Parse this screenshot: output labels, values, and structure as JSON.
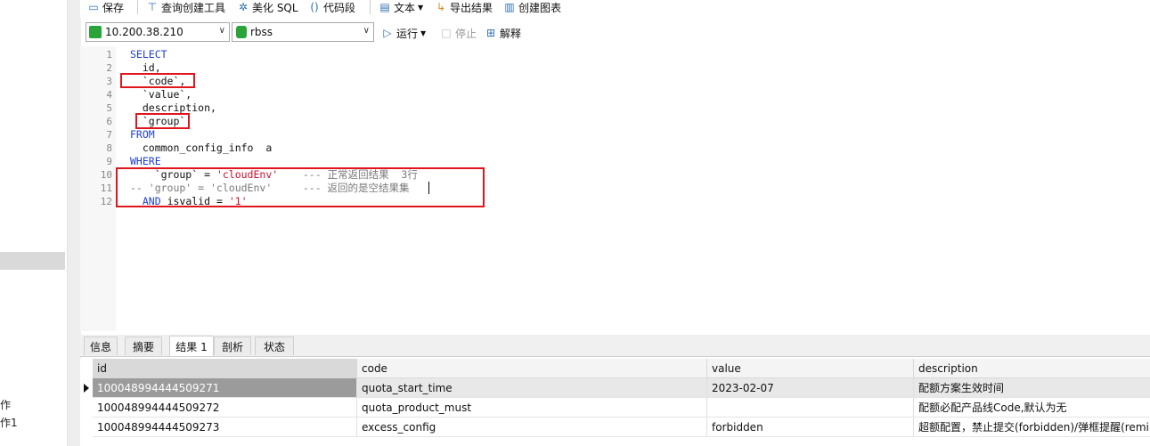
{
  "sidebar": {
    "items": [
      "作",
      "作1"
    ]
  },
  "toolbar": {
    "save": "保存",
    "query_builder": "查询创建工具",
    "beautify_sql": "美化 SQL",
    "code_snippet": "代码段",
    "text": "文本",
    "export_results": "导出结果",
    "create_chart": "创建图表",
    "connection": "10.200.38.210",
    "database": "rbss",
    "run": "运行",
    "stop": "停止",
    "explain": "解释"
  },
  "editor": {
    "line_numbers": [
      "1",
      "2",
      "3",
      "4",
      "5",
      "6",
      "7",
      "8",
      "9",
      "10",
      "11",
      "12"
    ],
    "lines": [
      {
        "parts": [
          {
            "t": "SELECT",
            "c": "kw"
          }
        ]
      },
      {
        "parts": [
          {
            "t": "  id,",
            "c": ""
          }
        ]
      },
      {
        "parts": [
          {
            "t": "  `code`,",
            "c": ""
          }
        ]
      },
      {
        "parts": [
          {
            "t": "  `value`,",
            "c": ""
          }
        ]
      },
      {
        "parts": [
          {
            "t": "  description,",
            "c": ""
          }
        ]
      },
      {
        "parts": [
          {
            "t": "  `group`",
            "c": ""
          }
        ]
      },
      {
        "parts": [
          {
            "t": "FROM",
            "c": "kw"
          }
        ]
      },
      {
        "parts": [
          {
            "t": "  common_config_info  a",
            "c": ""
          }
        ]
      },
      {
        "parts": [
          {
            "t": "WHERE",
            "c": "kw"
          }
        ]
      },
      {
        "parts": [
          {
            "t": "    `group` = ",
            "c": ""
          },
          {
            "t": "'cloudEnv'",
            "c": "str"
          },
          {
            "t": "    --- 正常返回结果  3行",
            "c": "cmt"
          }
        ]
      },
      {
        "parts": [
          {
            "t": "-- 'group' = 'cloudEnv'     --- 返回的是空结果集",
            "c": "cmt"
          }
        ]
      },
      {
        "parts": [
          {
            "t": "  ",
            "c": ""
          },
          {
            "t": "AND",
            "c": "kw"
          },
          {
            "t": " isvalid = ",
            "c": ""
          },
          {
            "t": "'1'",
            "c": "str"
          }
        ]
      }
    ]
  },
  "tabs": [
    "信息",
    "摘要",
    "结果 1",
    "剖析",
    "状态"
  ],
  "results": {
    "columns": [
      "id",
      "code",
      "value",
      "description"
    ],
    "rows": [
      [
        "100048994444509271",
        "quota_start_time",
        "2023-02-07",
        "配额方案生效时间"
      ],
      [
        "100048994444509272",
        "quota_product_must",
        "",
        "配额必配产品线Code,默认为无"
      ],
      [
        "100048994444509273",
        "excess_config",
        "forbidden",
        "超额配置，禁止提交(forbidden)/弹框提醒(remin"
      ]
    ]
  },
  "colors": {
    "keyword": "#1f3fcf",
    "string": "#c8102e",
    "comment": "#7a7a7a",
    "highlight_box": "#e0161d"
  }
}
